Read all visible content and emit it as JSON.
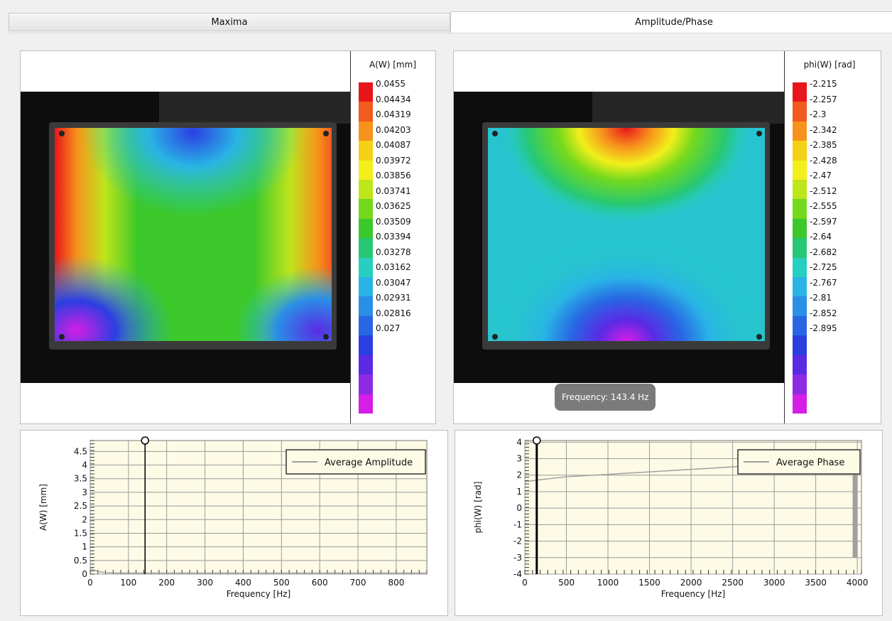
{
  "tabs": [
    {
      "label": "Maxima",
      "active": false
    },
    {
      "label": "Amplitude/Phase",
      "active": true
    }
  ],
  "left_map": {
    "scale_title": "A(W) [mm]",
    "scale_values": [
      "0.0455",
      "0.04434",
      "0.04319",
      "0.04203",
      "0.04087",
      "0.03972",
      "0.03856",
      "0.03741",
      "0.03625",
      "0.03509",
      "0.03394",
      "0.03278",
      "0.03162",
      "0.03047",
      "0.02931",
      "0.02816",
      "0.027"
    ]
  },
  "right_map": {
    "scale_title": "phi(W) [rad]",
    "scale_values": [
      "-2.215",
      "-2.257",
      "-2.3",
      "-2.342",
      "-2.385",
      "-2.428",
      "-2.47",
      "-2.512",
      "-2.555",
      "-2.597",
      "-2.64",
      "-2.682",
      "-2.725",
      "-2.767",
      "-2.81",
      "-2.852",
      "-2.895"
    ],
    "tooltip": "Frequency: 143.4 Hz"
  },
  "colors": {
    "scale": [
      "#e8151a",
      "#f25a1e",
      "#f7921c",
      "#f5d114",
      "#f2ef1b",
      "#bfe51b",
      "#74d91d",
      "#3cc82a",
      "#27c873",
      "#27cfc0",
      "#29b4e5",
      "#2a8fe6",
      "#2866e4",
      "#2b3ee2",
      "#5a2ae4",
      "#8d2ae4",
      "#d51ee6"
    ],
    "plot_bg": "#fdfbe6",
    "series": "#a0a0a0"
  },
  "chart_data": [
    {
      "type": "line",
      "xlabel": "Frequency [Hz]",
      "ylabel": "A(W) [mm]",
      "xlim": [
        0,
        880
      ],
      "ylim": [
        0,
        4.9
      ],
      "xticks": [
        0,
        100,
        200,
        300,
        400,
        500,
        600,
        700,
        800
      ],
      "yticks": [
        0,
        0.5,
        1,
        1.5,
        2,
        2.5,
        3,
        3.5,
        4,
        4.5
      ],
      "grid": true,
      "legend": "top-right",
      "cursor_x": 143.4,
      "series": [
        {
          "name": "Average Amplitude",
          "x": [
            0,
            10,
            20,
            40,
            80,
            143.4,
            200,
            300,
            400,
            500,
            600,
            700,
            800,
            880
          ],
          "values": [
            0.2,
            0.15,
            0.1,
            0.05,
            0.04,
            0.04,
            0.04,
            0.04,
            0.04,
            0.04,
            0.04,
            0.04,
            0.04,
            0.04
          ]
        }
      ]
    },
    {
      "type": "line",
      "xlabel": "Frequency [Hz]",
      "ylabel": "phi(W) [rad]",
      "xlim": [
        0,
        4050
      ],
      "ylim": [
        -4,
        4.1
      ],
      "xticks": [
        0,
        500,
        1000,
        1500,
        2000,
        2500,
        3000,
        3500,
        4000
      ],
      "yticks": [
        -4,
        -3,
        -2,
        -1,
        0,
        1,
        2,
        3,
        4
      ],
      "grid": true,
      "legend": "top-right",
      "cursor_x": 143.4,
      "series": [
        {
          "name": "Average Phase",
          "x": [
            0,
            143.4,
            500,
            1000,
            1500,
            2000,
            2500,
            3000,
            3500,
            3950,
            3950,
            3950
          ],
          "values": [
            1.6,
            1.7,
            1.9,
            2.05,
            2.2,
            2.35,
            2.5,
            2.7,
            2.9,
            3.1,
            -3,
            3.1
          ]
        }
      ]
    }
  ]
}
